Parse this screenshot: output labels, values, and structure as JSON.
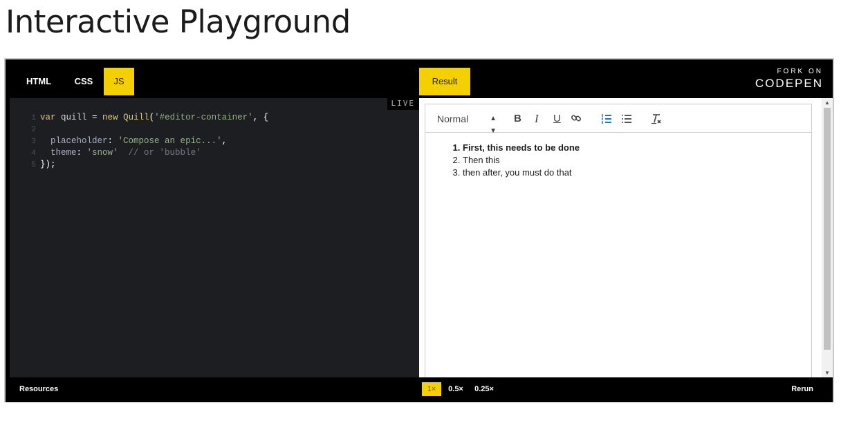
{
  "page": {
    "title": "Interactive Playground"
  },
  "embed": {
    "tabs": [
      {
        "label": "HTML",
        "active": false
      },
      {
        "label": "CSS",
        "active": false
      },
      {
        "label": "JS",
        "active": true
      }
    ],
    "result_tab": "Result",
    "fork": {
      "small": "FORK ON",
      "brand": "CODEPEN"
    },
    "live_badge": "LIVE",
    "bottom": {
      "resources": "Resources",
      "zoom": [
        "1×",
        "0.5×",
        "0.25×"
      ],
      "zoom_selected": "1×",
      "rerun": "Rerun"
    },
    "colors": {
      "accent": "#f5d000",
      "code_bg": "#1d1e22",
      "bar_bg": "#000000"
    }
  },
  "code": {
    "lines": [
      {
        "n": "1",
        "tokens": [
          {
            "t": "var",
            "c": "kw"
          },
          {
            "t": " quill ",
            "c": "vr"
          },
          {
            "t": "=",
            "c": "pun"
          },
          {
            "t": " new ",
            "c": "kw"
          },
          {
            "t": "Quill",
            "c": "fn"
          },
          {
            "t": "(",
            "c": "pun"
          },
          {
            "t": "'#editor-container'",
            "c": "str"
          },
          {
            "t": ", {",
            "c": "pun"
          }
        ]
      },
      {
        "n": "2",
        "tokens": []
      },
      {
        "n": "3",
        "tokens": [
          {
            "t": "  placeholder",
            "c": "prop"
          },
          {
            "t": ": ",
            "c": "pun"
          },
          {
            "t": "'Compose an epic...'",
            "c": "str"
          },
          {
            "t": ",",
            "c": "pun"
          }
        ]
      },
      {
        "n": "4",
        "tokens": [
          {
            "t": "  theme",
            "c": "prop"
          },
          {
            "t": ": ",
            "c": "pun"
          },
          {
            "t": "'snow'",
            "c": "str"
          },
          {
            "t": "  // or 'bubble'",
            "c": "cm"
          }
        ]
      },
      {
        "n": "5",
        "tokens": [
          {
            "t": "});",
            "c": "pun"
          }
        ]
      }
    ]
  },
  "editor": {
    "header_select": "Normal",
    "toolbar": {
      "bold": "B",
      "italic": "I",
      "underline": "U",
      "ordered_list_active": true
    },
    "list_items": [
      {
        "text": "First, this needs to be done",
        "bold": true
      },
      {
        "text": "Then this",
        "bold": false
      },
      {
        "text": "then after, you must do that",
        "bold": false
      }
    ]
  }
}
